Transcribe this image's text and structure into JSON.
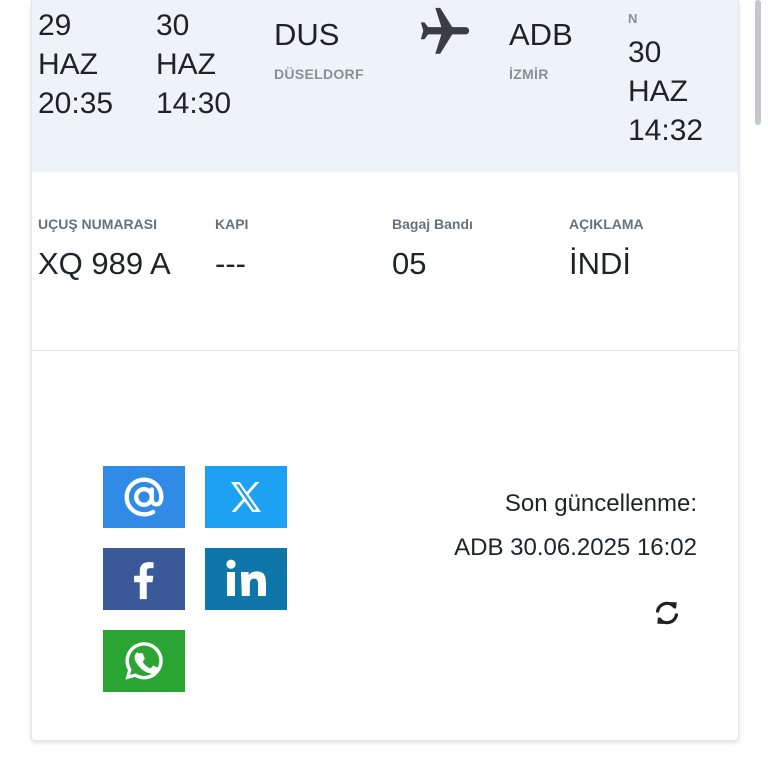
{
  "flight_top": {
    "col1": {
      "day": "29",
      "month": "HAZ",
      "time": "20:35"
    },
    "col2": {
      "day": "30",
      "month": "HAZ",
      "time": "14:30"
    },
    "origin": {
      "code": "DUS",
      "city": "DÜSELDORF"
    },
    "destination": {
      "code": "ADB",
      "city": "İZMİR"
    },
    "col_right": {
      "partial_label": "N",
      "day": "30",
      "month": "HAZ",
      "time": "14:32"
    },
    "plane_icon": "airplane-icon"
  },
  "details": {
    "flight_number": {
      "label": "UÇUŞ NUMARASI",
      "value": "XQ 989 A"
    },
    "gate": {
      "label": "KAPI",
      "value": "---"
    },
    "baggage": {
      "label": "Bagaj Bandı",
      "value": "05"
    },
    "status": {
      "label": "AÇIKLAMA",
      "value": "İNDİ"
    }
  },
  "share": {
    "email": {
      "icon": "at-sign-icon",
      "color": "#2f8be6"
    },
    "x": {
      "icon": "x-logo-icon",
      "color": "#1da1f2"
    },
    "facebook": {
      "icon": "facebook-icon",
      "color": "#3b5998"
    },
    "linkedin": {
      "icon": "linkedin-icon",
      "color": "#0e76a8"
    },
    "whatsapp": {
      "icon": "whatsapp-icon",
      "color": "#2aa534"
    }
  },
  "update": {
    "label": "Son güncellenme:",
    "value": "ADB 30.06.2025 16:02",
    "refresh_icon": "refresh-icon"
  }
}
